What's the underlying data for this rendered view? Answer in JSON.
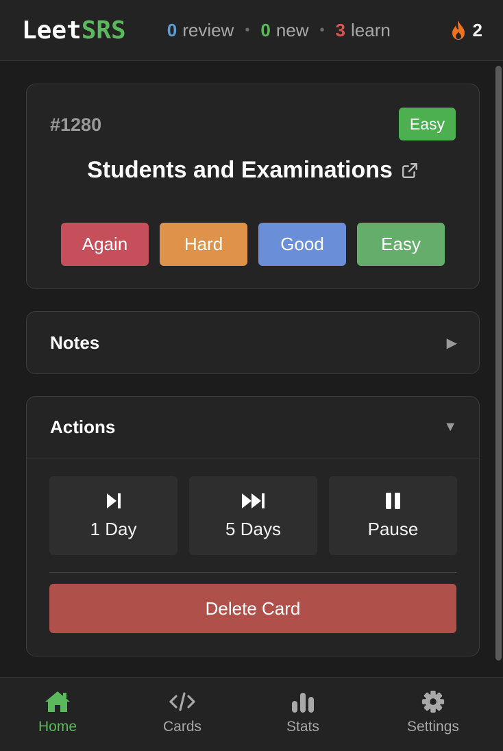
{
  "header": {
    "logo_leet": "Leet",
    "logo_srs": "SRS",
    "review_count": "0",
    "review_label": "review",
    "new_count": "0",
    "new_label": "new",
    "learn_count": "3",
    "learn_label": "learn",
    "separator": "•",
    "streak": "2",
    "colors": {
      "review": "#5b9fd6",
      "new": "#5cb85c",
      "learn": "#d9534f",
      "flame": "#f0711e"
    }
  },
  "card": {
    "problem_id": "#1280",
    "difficulty": "Easy",
    "title": "Students and Examinations",
    "external_link_icon": "external-link-icon",
    "ratings": [
      {
        "label": "Again",
        "color": "#c64f5c"
      },
      {
        "label": "Hard",
        "color": "#de924a"
      },
      {
        "label": "Good",
        "color": "#6a8fd8"
      },
      {
        "label": "Easy",
        "color": "#65ad6b"
      }
    ]
  },
  "notes": {
    "title": "Notes",
    "chevron": "▶"
  },
  "actions": {
    "title": "Actions",
    "chevron": "▼",
    "buttons": [
      {
        "label": "1 Day",
        "icon": "skip-forward-icon"
      },
      {
        "label": "5 Days",
        "icon": "fast-forward-icon"
      },
      {
        "label": "Pause",
        "icon": "pause-icon"
      }
    ],
    "delete_label": "Delete Card"
  },
  "nav": {
    "items": [
      {
        "label": "Home",
        "icon": "home-icon",
        "active": true
      },
      {
        "label": "Cards",
        "icon": "code-icon",
        "active": false
      },
      {
        "label": "Stats",
        "icon": "bar-chart-icon",
        "active": false
      },
      {
        "label": "Settings",
        "icon": "gear-icon",
        "active": false
      }
    ],
    "active_color": "#5cb85c"
  }
}
